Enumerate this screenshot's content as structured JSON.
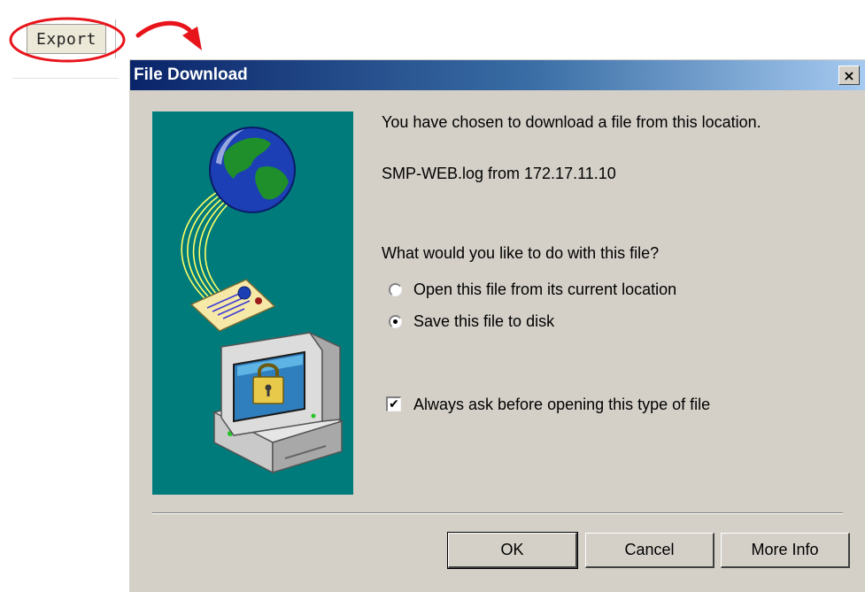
{
  "toolbar": {
    "export_label": "Export"
  },
  "dialog": {
    "title": "File Download",
    "close_glyph": "×",
    "message": "You have chosen to download a file from this location.",
    "file_info": "SMP-WEB.log from 172.17.11.10",
    "question": "What would you like to do with this file?",
    "options": [
      {
        "label": "Open this file from its current location",
        "selected": false
      },
      {
        "label": "Save this file to disk",
        "selected": true
      }
    ],
    "always_ask": {
      "label": "Always ask before opening this type of file",
      "checked": true,
      "check_glyph": "✔"
    },
    "buttons": {
      "ok": "OK",
      "cancel": "Cancel",
      "more_info": "More Info"
    }
  },
  "colors": {
    "title_gradient_start": "#0a246a",
    "title_gradient_end": "#a6caf0",
    "dialog_face": "#d4d0c8",
    "illustration_bg": "#007b7b",
    "annotation_red": "#e8141b"
  }
}
